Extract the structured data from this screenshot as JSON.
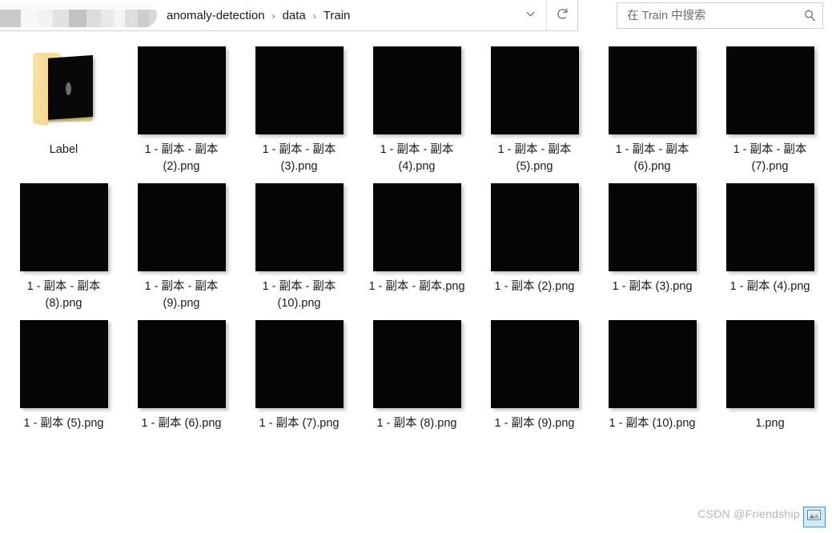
{
  "window": {
    "addressbar": {
      "redacted_label": "redacted-path-segment",
      "crumbs": [
        "anomaly-detection",
        "data",
        "Train"
      ],
      "separator": "›",
      "history_dropdown_icon": "chevron-down-icon",
      "refresh_icon": "refresh-icon"
    },
    "search": {
      "placeholder": "在 Train 中搜索",
      "value": "",
      "icon": "search-icon"
    }
  },
  "items": [
    {
      "name": "Label",
      "type": "folder",
      "icon": "folder-with-image-thumbnail-icon"
    },
    {
      "name": "1 - 副本 - 副本 (2).png",
      "type": "image",
      "icon": "black-image-thumbnail"
    },
    {
      "name": "1 - 副本 - 副本 (3).png",
      "type": "image",
      "icon": "black-image-thumbnail"
    },
    {
      "name": "1 - 副本 - 副本 (4).png",
      "type": "image",
      "icon": "black-image-thumbnail"
    },
    {
      "name": "1 - 副本 - 副本 (5).png",
      "type": "image",
      "icon": "black-image-thumbnail"
    },
    {
      "name": "1 - 副本 - 副本 (6).png",
      "type": "image",
      "icon": "black-image-thumbnail"
    },
    {
      "name": "1 - 副本 - 副本 (7).png",
      "type": "image",
      "icon": "black-image-thumbnail"
    },
    {
      "name": "1 - 副本 - 副本 (8).png",
      "type": "image",
      "icon": "black-image-thumbnail"
    },
    {
      "name": "1 - 副本 - 副本 (9).png",
      "type": "image",
      "icon": "black-image-thumbnail"
    },
    {
      "name": "1 - 副本 - 副本 (10).png",
      "type": "image",
      "icon": "black-image-thumbnail"
    },
    {
      "name": "1 - 副本 - 副本.png",
      "type": "image",
      "icon": "black-image-thumbnail"
    },
    {
      "name": "1 - 副本 (2).png",
      "type": "image",
      "icon": "black-image-thumbnail"
    },
    {
      "name": "1 - 副本 (3).png",
      "type": "image",
      "icon": "black-image-thumbnail"
    },
    {
      "name": "1 - 副本 (4).png",
      "type": "image",
      "icon": "black-image-thumbnail"
    },
    {
      "name": "1 - 副本 (5).png",
      "type": "image",
      "icon": "black-image-thumbnail"
    },
    {
      "name": "1 - 副本 (6).png",
      "type": "image",
      "icon": "black-image-thumbnail"
    },
    {
      "name": "1 - 副本 (7).png",
      "type": "image",
      "icon": "black-image-thumbnail"
    },
    {
      "name": "1 - 副本 (8).png",
      "type": "image",
      "icon": "black-image-thumbnail"
    },
    {
      "name": "1 - 副本 (9).png",
      "type": "image",
      "icon": "black-image-thumbnail"
    },
    {
      "name": "1 - 副本 (10).png",
      "type": "image",
      "icon": "black-image-thumbnail"
    },
    {
      "name": "1.png",
      "type": "image",
      "icon": "black-image-thumbnail"
    }
  ],
  "statusbar": {
    "watermark": "CSDN @Friendship",
    "view_large_icons_icon": "large-icons-view-icon",
    "view_selected": true
  },
  "colors": {
    "background": "#ffffff",
    "text": "#1b1b1b",
    "placeholder": "#6d6d6d",
    "thumbnail": "#050505",
    "folder": "#f6dd96",
    "border": "#cfcfcf",
    "accent_selected_border": "#2e9fd6",
    "accent_selected_fill": "#cfe9f7",
    "watermark": "#b6b6b6"
  },
  "layout": {
    "columns": 7,
    "rows": 3
  }
}
